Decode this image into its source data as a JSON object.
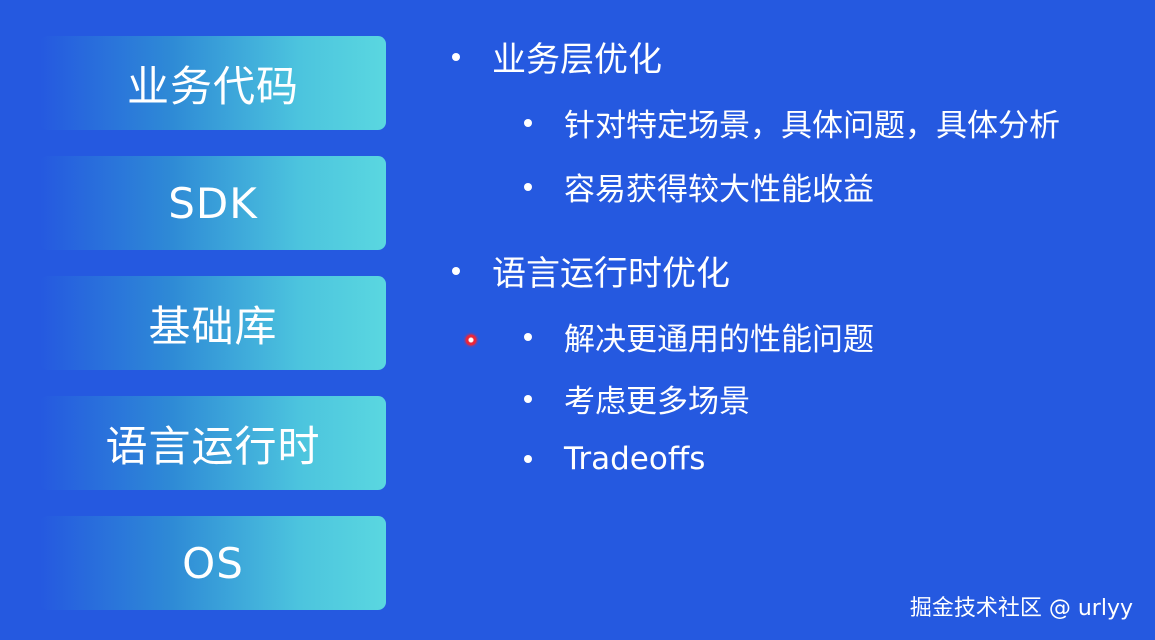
{
  "layers": [
    {
      "label": "业务代码"
    },
    {
      "label": "SDK"
    },
    {
      "label": "基础库"
    },
    {
      "label": "语言运行时"
    },
    {
      "label": "OS"
    }
  ],
  "sections": [
    {
      "title": "业务层优化",
      "points": [
        "针对特定场景，具体问题，具体分析",
        "容易获得较大性能收益"
      ]
    },
    {
      "title": "语言运行时优化",
      "points": [
        "解决更通用的性能问题",
        "考虑更多场景",
        "Tradeoffs"
      ]
    }
  ],
  "watermark": "掘金技术社区 @ urlyy"
}
